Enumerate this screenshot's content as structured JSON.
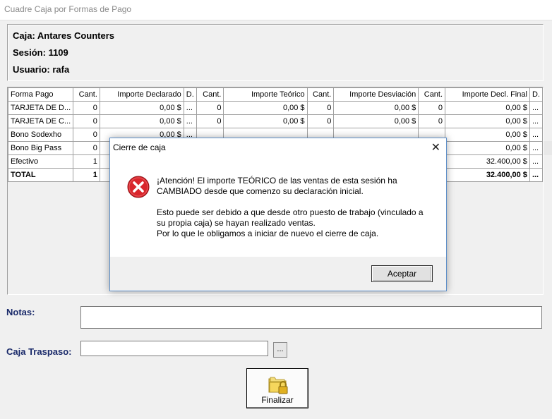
{
  "window": {
    "title": "Cuadre Caja por Formas de Pago"
  },
  "header": {
    "caja": "Caja: Antares Counters",
    "sesion": "Sesión: 1109",
    "usuario": "Usuario: rafa"
  },
  "grid": {
    "columns": [
      "Forma Pago",
      "Cant.",
      "Importe Declarado",
      "D.",
      "Cant.",
      "Importe Teórico",
      "Cant.",
      "Importe Desviación",
      "Cant.",
      "Importe Decl. Final",
      "D."
    ],
    "rows": [
      {
        "c0": "TARJETA DE D...",
        "c1": "0",
        "c2": "0,00 $",
        "c3": "...",
        "c4": "0",
        "c5": "0,00 $",
        "c6": "0",
        "c7": "0,00 $",
        "c8": "0",
        "c9": "0,00 $",
        "c10": "..."
      },
      {
        "c0": "TARJETA DE C...",
        "c1": "0",
        "c2": "0,00 $",
        "c3": "...",
        "c4": "0",
        "c5": "0,00 $",
        "c6": "0",
        "c7": "0,00 $",
        "c8": "0",
        "c9": "0,00 $",
        "c10": "..."
      },
      {
        "c0": "Bono Sodexho",
        "c1": "0",
        "c2": "0,00 $",
        "c3": "...",
        "c4": "",
        "c5": "",
        "c6": "",
        "c7": "",
        "c8": "",
        "c9": "0,00 $",
        "c10": "..."
      },
      {
        "c0": "Bono Big Pass",
        "c1": "0",
        "c2": "",
        "c3": "",
        "c4": "",
        "c5": "",
        "c6": "",
        "c7": "",
        "c8": "",
        "c9": "0,00 $",
        "c10": "..."
      },
      {
        "c0": "Efectivo",
        "c1": "1",
        "c2": "",
        "c3": "",
        "c4": "",
        "c5": "",
        "c6": "",
        "c7": "",
        "c8": "",
        "c9": "32.400,00 $",
        "c10": "..."
      }
    ],
    "total": {
      "c0": "TOTAL",
      "c1": "1",
      "c9": "32.400,00 $",
      "c10": "..."
    }
  },
  "form": {
    "notas_label": "Notas:",
    "notas_value": "",
    "caja_traspaso_label": "Caja Traspaso:",
    "caja_traspaso_value": "",
    "browse_label": "...",
    "finalizar_label": "Finalizar",
    "finalizar_icon": "folder-lock-icon"
  },
  "dialog": {
    "title": "Cierre de caja",
    "close": "✕",
    "icon": "error-icon",
    "paragraph1": "¡Atención! El importe TEÓRICO de las ventas de esta sesión ha\nCAMBIADO desde que comenzo su declaración inicial.",
    "paragraph2": "Esto puede ser debido a que desde otro puesto de trabajo (vinculado a\nsu propia caja) se hayan realizado ventas.\nPor lo que le obligamos a iniciar de nuevo el cierre de caja.",
    "ok_label": "Aceptar"
  },
  "colors": {
    "label_blue": "#1a2a6a",
    "error_red": "#d9262c",
    "dialog_border": "#5e8fc8"
  }
}
